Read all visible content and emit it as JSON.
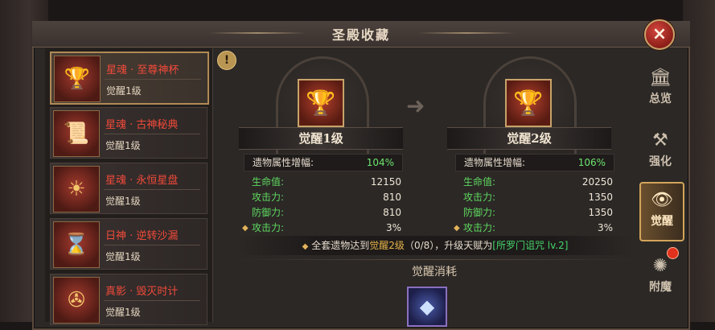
{
  "window": {
    "title": "圣殿收藏",
    "close_icon": "×"
  },
  "list": {
    "items": [
      {
        "name": "星魂 · 至尊神杯",
        "level": "觉醒1级",
        "icon": "🏆",
        "selected": true
      },
      {
        "name": "星魂 · 古神秘典",
        "level": "觉醒1级",
        "icon": "📜",
        "selected": false
      },
      {
        "name": "星魂 · 永恒星盘",
        "level": "觉醒1级",
        "icon": "☀",
        "selected": false
      },
      {
        "name": "日神 · 逆转沙漏",
        "level": "觉醒1级",
        "icon": "⌛",
        "selected": false
      },
      {
        "name": "真影 · 毁灭时计",
        "level": "觉醒1级",
        "icon": "✇",
        "selected": false
      }
    ]
  },
  "info_icon": "!",
  "current": {
    "level_label": "觉醒1级",
    "bonus_label": "遗物属性增幅:",
    "bonus_value": "104%",
    "stats": [
      {
        "key": "生命值:",
        "value": "12150"
      },
      {
        "key": "攻击力:",
        "value": "810"
      },
      {
        "key": "防御力:",
        "value": "810"
      },
      {
        "key": "攻击力:",
        "value": "3%",
        "diamond": true
      }
    ]
  },
  "next": {
    "level_label": "觉醒2级",
    "bonus_label": "遗物属性增幅:",
    "bonus_value": "106%",
    "stats": [
      {
        "key": "生命值:",
        "value": "20250"
      },
      {
        "key": "攻击力:",
        "value": "1350"
      },
      {
        "key": "防御力:",
        "value": "1350"
      },
      {
        "key": "攻击力:",
        "value": "3%",
        "diamond": true
      }
    ]
  },
  "set_note": {
    "prefix": "全套遗物达到",
    "highlight": "觉醒2级",
    "middle": "（0/8），升级天赋为",
    "talent": "[所罗门诅咒 lv.2]"
  },
  "cost_title": "觉醒消耗",
  "tabs": [
    {
      "label": "总览",
      "icon": "🏛",
      "selected": false
    },
    {
      "label": "强化",
      "icon": "⚒",
      "selected": false
    },
    {
      "label": "觉醒",
      "icon": "👁",
      "selected": true
    },
    {
      "label": "附魔",
      "icon": "✺",
      "selected": false,
      "badge": true
    }
  ],
  "colors": {
    "accent_gold": "#d2a55a",
    "stat_green": "#5fd85f",
    "name_red": "#f24a3a"
  }
}
